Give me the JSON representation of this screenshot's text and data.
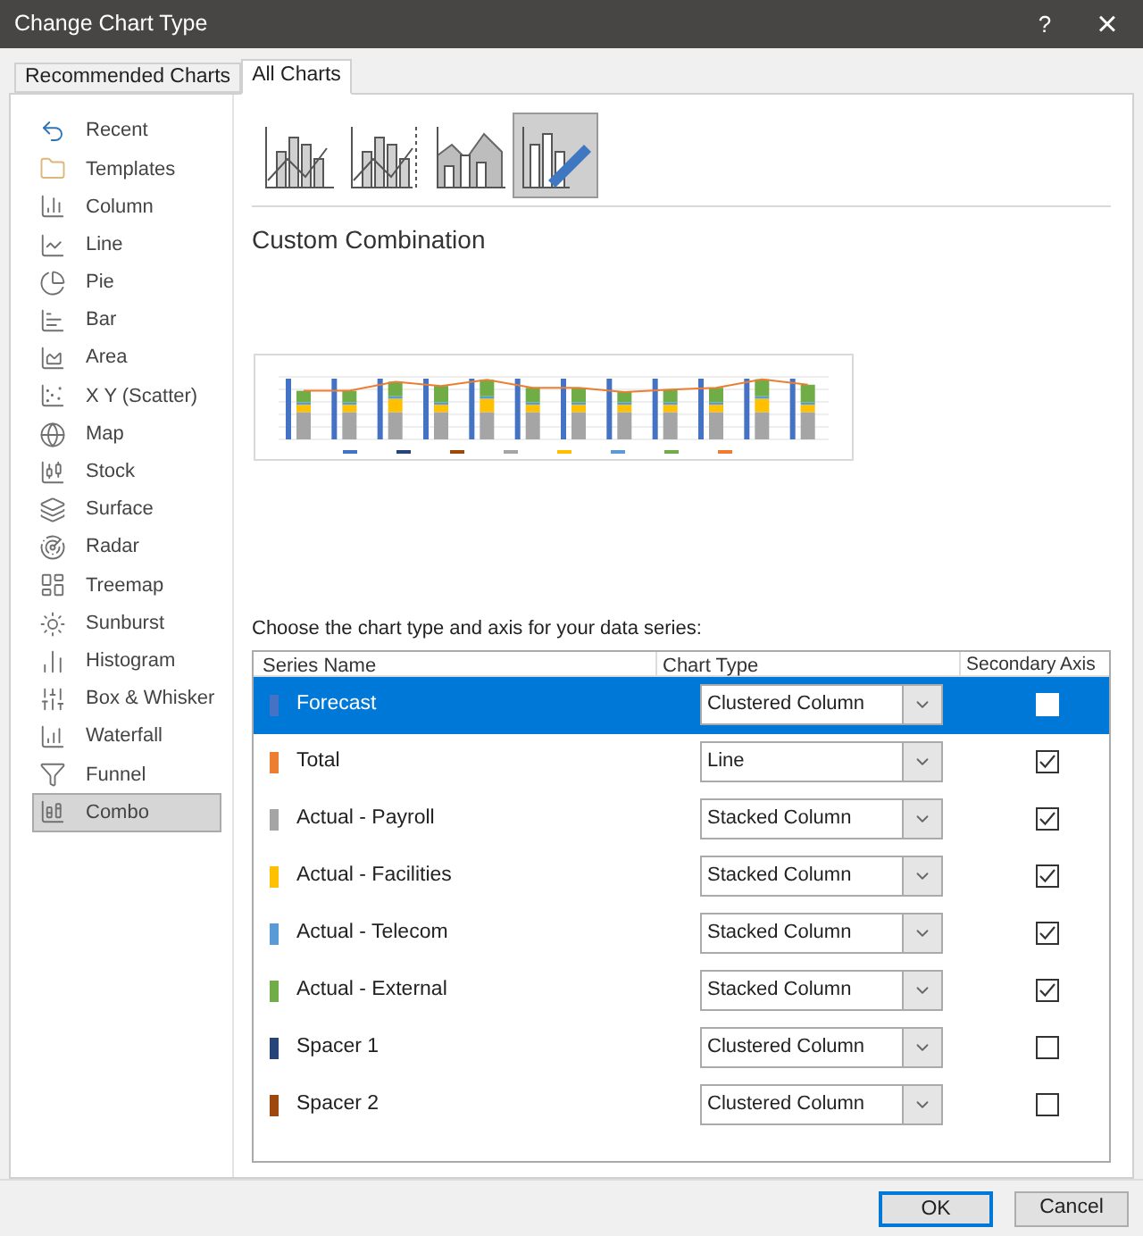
{
  "window": {
    "title": "Change Chart Type",
    "help": "?",
    "close": "×"
  },
  "tabs": [
    {
      "label": "Recommended Charts",
      "selected": false
    },
    {
      "label": "All Charts",
      "selected": true
    }
  ],
  "sidebar": {
    "items": [
      {
        "label": "Recent",
        "selected": false
      },
      {
        "label": "Templates",
        "selected": false
      },
      {
        "label": "Column",
        "selected": false
      },
      {
        "label": "Line",
        "selected": false
      },
      {
        "label": "Pie",
        "selected": false
      },
      {
        "label": "Bar",
        "selected": false
      },
      {
        "label": "Area",
        "selected": false
      },
      {
        "label": "X Y (Scatter)",
        "selected": false
      },
      {
        "label": "Map",
        "selected": false
      },
      {
        "label": "Stock",
        "selected": false
      },
      {
        "label": "Surface",
        "selected": false
      },
      {
        "label": "Radar",
        "selected": false
      },
      {
        "label": "Treemap",
        "selected": false
      },
      {
        "label": "Sunburst",
        "selected": false
      },
      {
        "label": "Histogram",
        "selected": false
      },
      {
        "label": "Box & Whisker",
        "selected": false
      },
      {
        "label": "Waterfall",
        "selected": false
      },
      {
        "label": "Funnel",
        "selected": false
      },
      {
        "label": "Combo",
        "selected": true
      }
    ]
  },
  "subtypes": [
    {
      "selected": false
    },
    {
      "selected": false
    },
    {
      "selected": false
    },
    {
      "selected": true
    }
  ],
  "heading": "Custom Combination",
  "instruction": "Choose the chart type and axis for your data series:",
  "table": {
    "columns": [
      "Series Name",
      "Chart Type",
      "Secondary Axis"
    ],
    "rows": [
      {
        "name": "Forecast",
        "color": "#4472c4",
        "chart_type": "Clustered Column",
        "secondary_axis": false,
        "selected": true
      },
      {
        "name": "Total",
        "color": "#ed7d31",
        "chart_type": "Line",
        "secondary_axis": true,
        "selected": false
      },
      {
        "name": "Actual - Payroll",
        "color": "#a5a5a5",
        "chart_type": "Stacked Column",
        "secondary_axis": true,
        "selected": false
      },
      {
        "name": "Actual - Facilities",
        "color": "#ffc000",
        "chart_type": "Stacked Column",
        "secondary_axis": true,
        "selected": false
      },
      {
        "name": "Actual - Telecom",
        "color": "#5b9bd5",
        "chart_type": "Stacked Column",
        "secondary_axis": true,
        "selected": false
      },
      {
        "name": "Actual - External",
        "color": "#70ad47",
        "chart_type": "Stacked Column",
        "secondary_axis": true,
        "selected": false
      },
      {
        "name": "Spacer 1",
        "color": "#264478",
        "chart_type": "Clustered Column",
        "secondary_axis": false,
        "selected": false
      },
      {
        "name": "Spacer 2",
        "color": "#9e480e",
        "chart_type": "Clustered Column",
        "secondary_axis": false,
        "selected": false
      }
    ]
  },
  "buttons": [
    {
      "label": "OK",
      "kind": "default"
    },
    {
      "label": "Cancel",
      "kind": "normal"
    }
  ]
}
